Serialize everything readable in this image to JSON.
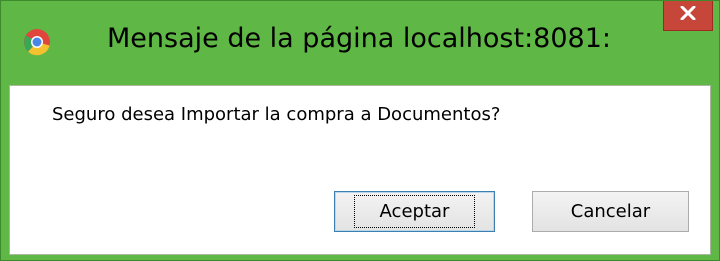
{
  "window": {
    "title": "Mensaje de la página localhost:8081:",
    "app_icon": "chrome-icon",
    "close_icon": "close-icon"
  },
  "dialog": {
    "message": "Seguro desea Importar la compra a Documentos?",
    "ok_label": "Aceptar",
    "cancel_label": "Cancelar"
  },
  "colors": {
    "titlebar": "#5fb746",
    "close_button": "#c7463a",
    "dialog_background": "#ffffff"
  }
}
